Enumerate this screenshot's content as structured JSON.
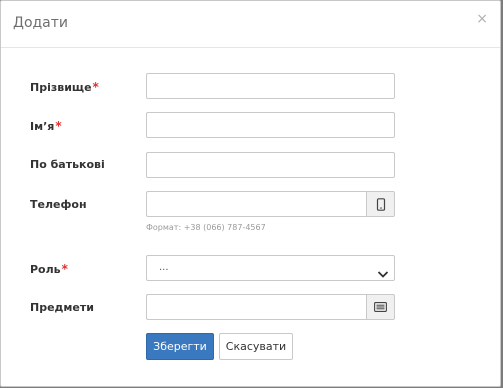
{
  "modal": {
    "title": "Додати",
    "close_icon": "×"
  },
  "form": {
    "surname": {
      "label": "Прізвище",
      "required_mark": "*",
      "value": ""
    },
    "name": {
      "label": "Ім’я",
      "required_mark": "*",
      "value": ""
    },
    "patronymic": {
      "label": "По батькові",
      "value": ""
    },
    "phone": {
      "label": "Телефон",
      "value": "",
      "icon": "mobile-phone-icon",
      "hint": "Формат: +38 (066) 787-4567"
    },
    "role": {
      "label": "Роль",
      "required_mark": "*",
      "selected": "..."
    },
    "subjects": {
      "label": "Предмети",
      "value": "",
      "icon": "list-icon"
    }
  },
  "buttons": {
    "save": "Зберегти",
    "cancel": "Скасувати"
  },
  "colors": {
    "primary": "#3a78c0",
    "required": "#e02f2f",
    "overlay": "#7c7c7c"
  }
}
